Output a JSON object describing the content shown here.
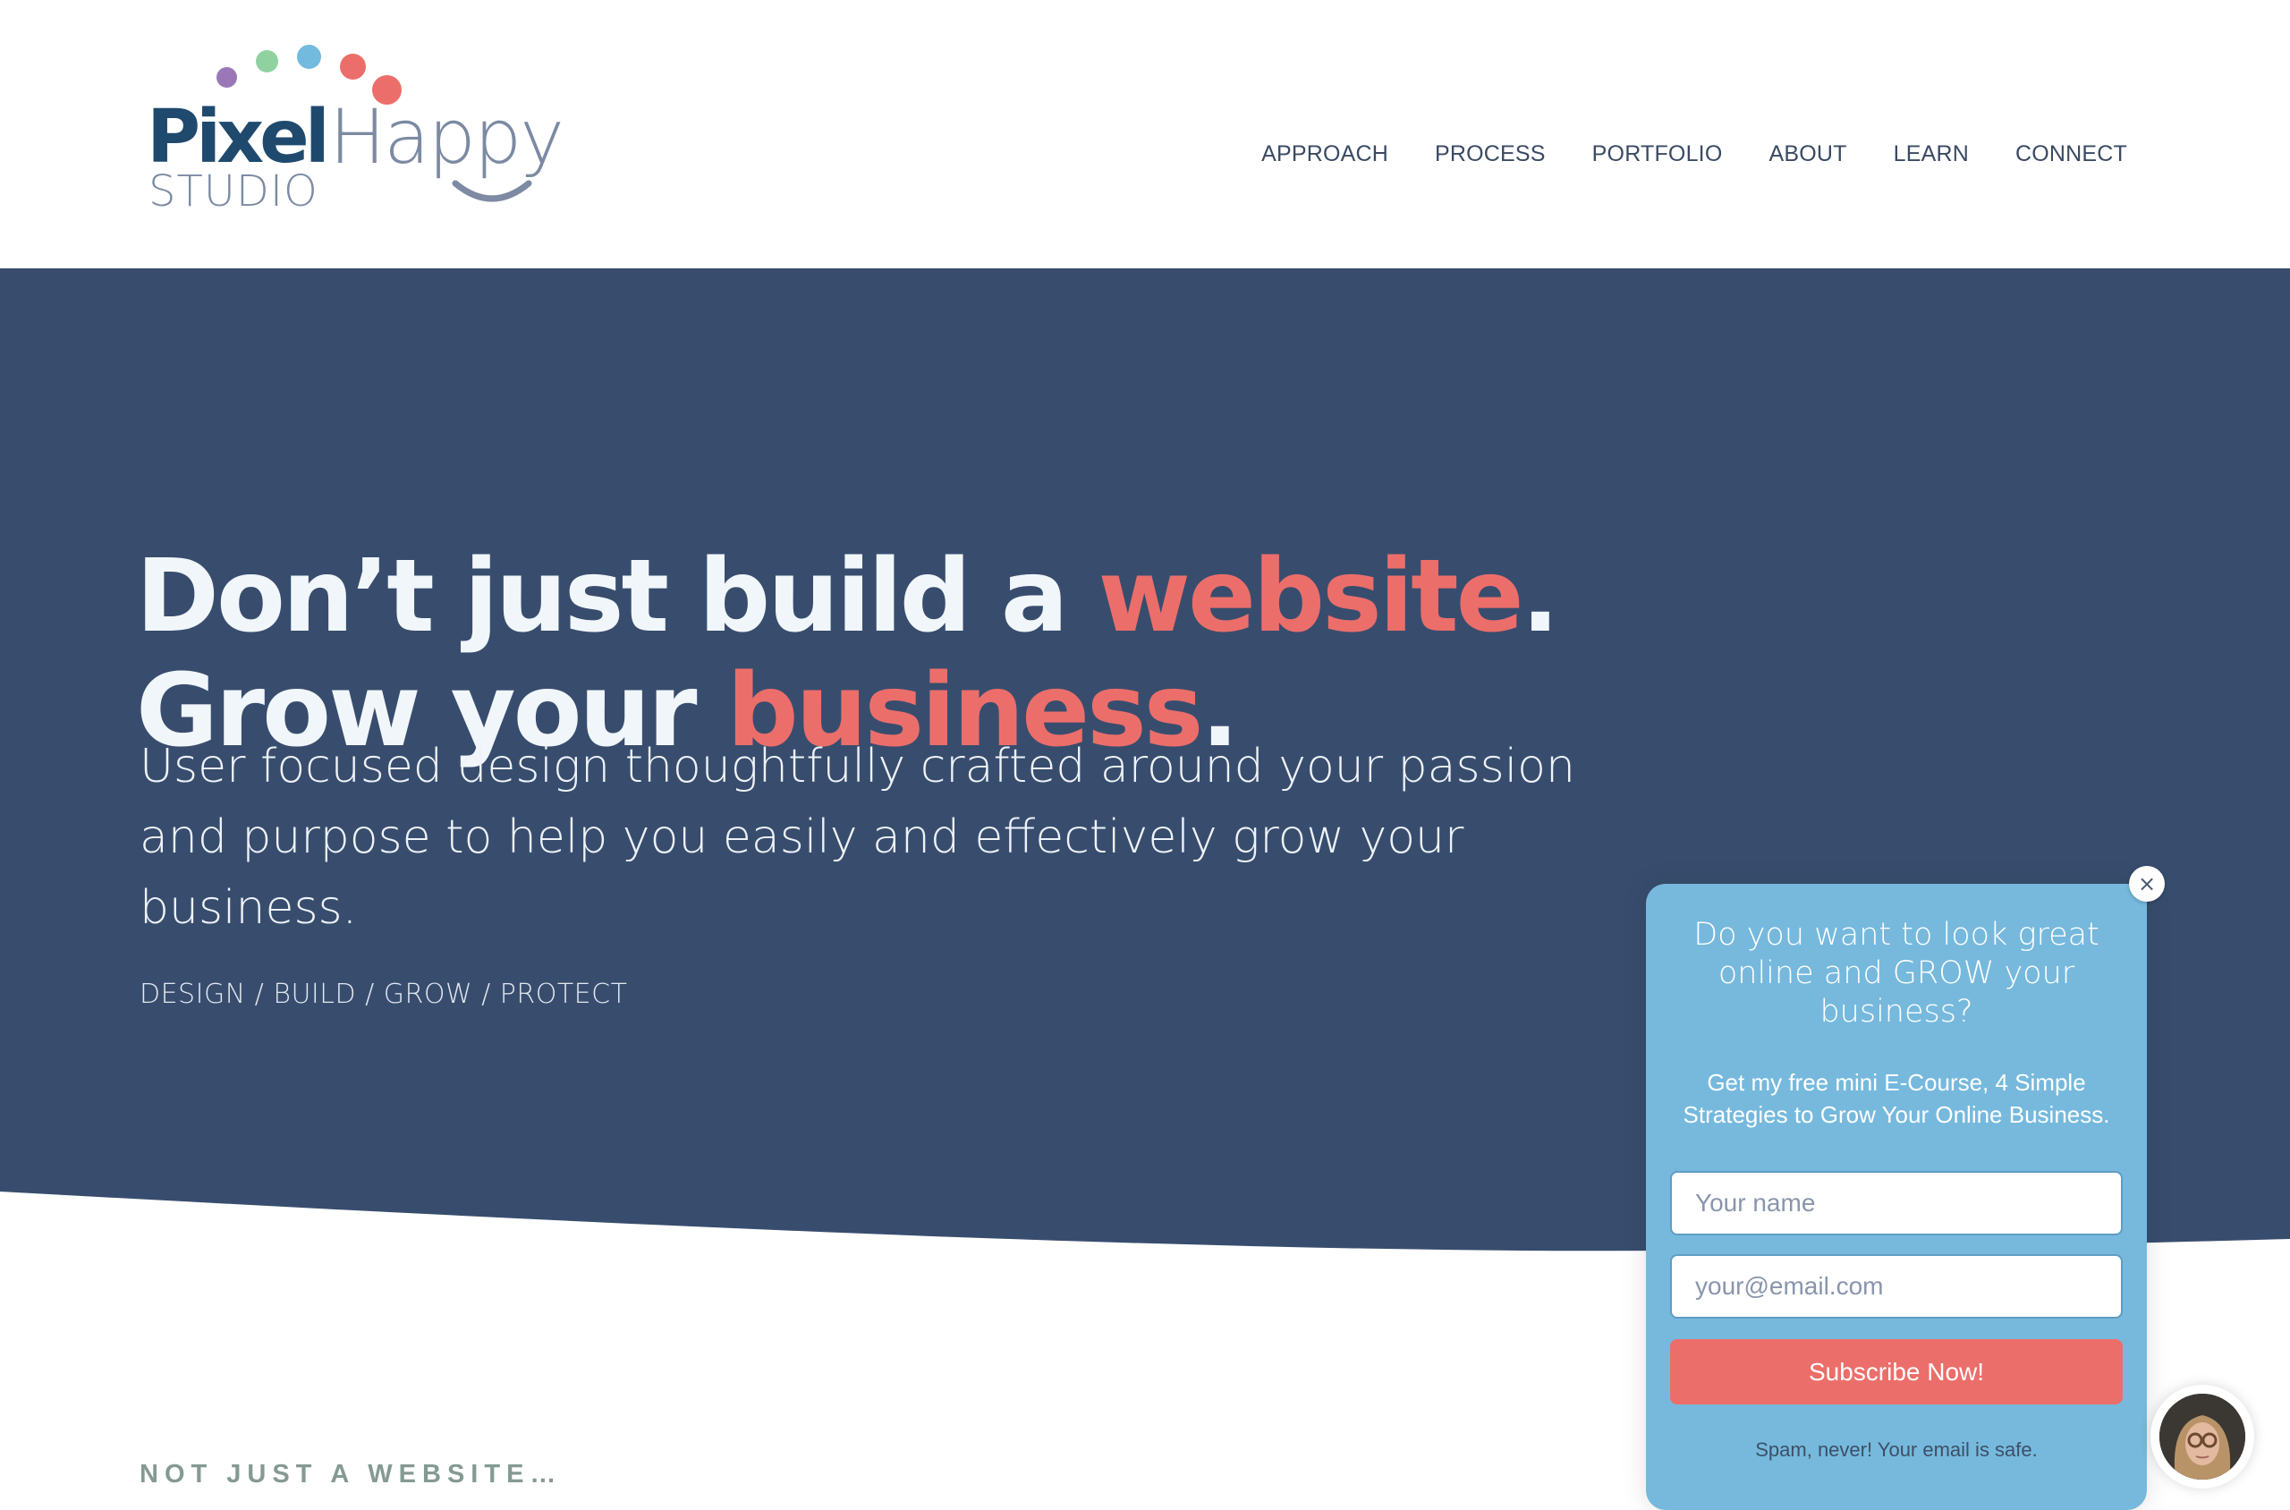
{
  "brand": {
    "logo_word1": "Pixel",
    "logo_word2": "Happy",
    "logo_word3": "STUDIO",
    "dot_colors": [
      "#9a78b7",
      "#8fd2a0",
      "#73badf",
      "#ec6e6a",
      "#ec6e6a"
    ],
    "primary_color": "#1f4a6e"
  },
  "nav": {
    "items": [
      {
        "label": "APPROACH"
      },
      {
        "label": "PROCESS"
      },
      {
        "label": "PORTFOLIO"
      },
      {
        "label": "ABOUT"
      },
      {
        "label": "LEARN"
      },
      {
        "label": "CONNECT"
      }
    ]
  },
  "hero": {
    "line1_prefix": "Don’t just build a ",
    "line1_accent": "website",
    "line1_suffix": ".",
    "line2_prefix": "Grow your ",
    "line2_accent": "business",
    "line2_suffix": ".",
    "subtitle": "User focused design thoughtfully crafted around your passion and purpose to help you easily and effectively grow your business.",
    "tagline": "DESIGN / BUILD / GROW / PROTECT",
    "background_color": "#384d6e",
    "accent_color": "#ec6e6a"
  },
  "section": {
    "label": "NOT JUST A WEBSITE…"
  },
  "popup": {
    "title": "Do you want to look great online and GROW your business?",
    "description": "Get my free mini E-Course, 4 Simple Strategies to Grow Your Online Business.",
    "name_placeholder": "Your name",
    "name_value": "",
    "email_placeholder": "your@email.com",
    "email_value": "",
    "submit_label": "Subscribe Now!",
    "disclaimer": "Spam, never! Your email is safe.",
    "close_icon": "×",
    "background_color": "#76b9dd",
    "button_color": "#ec6e6a"
  },
  "chat": {
    "avatar_icon": "person-avatar"
  }
}
